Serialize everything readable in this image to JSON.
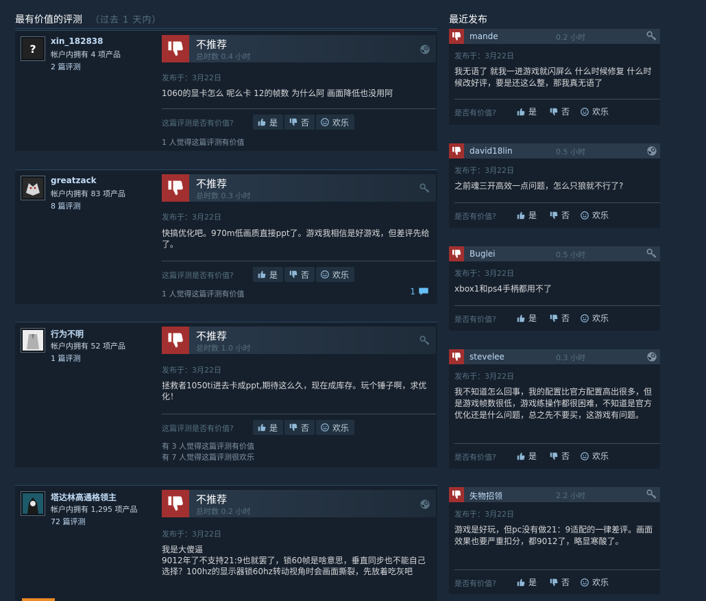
{
  "left_header": {
    "title": "最有价值的评测",
    "subtitle": "（过去 1 天内）"
  },
  "right_header": {
    "title": "最近发布"
  },
  "labels": {
    "helpful_q": "这篇评测是否有价值?",
    "yes": "是",
    "no": "否",
    "funny": "欢乐",
    "recent_helpful_q": "是否有价值?"
  },
  "reviews": [
    {
      "author": "xin_182838",
      "owned": "帐户内拥有 4 项产品",
      "review_count": "2 篇评测",
      "verdict": "不推荐",
      "hours": "总时数 0.4 小时",
      "platform": "steam-icon",
      "posted": "发布于：3月22日",
      "text": "1060的显卡怎么 呢么卡 12的帧数 为什么阿 画面降低也没用阿",
      "found": [
        "1 人觉得这篇评测有价值"
      ]
    },
    {
      "author": "greatzack",
      "owned": "帐户内拥有 83 项产品",
      "review_count": "8 篇评测",
      "verdict": "不推荐",
      "hours": "总时数 0.3 小时",
      "platform": "key-icon",
      "posted": "发布于：3月22日",
      "text": "快搞优化吧。970m低画质直接ppt了。游戏我相信是好游戏，但差评先给了。",
      "found": [
        "1 人觉得这篇评测有价值"
      ],
      "comments": "1"
    },
    {
      "author": "行为不明",
      "owned": "帐户内拥有 52 项产品",
      "review_count": "1 篇评测",
      "verdict": "不推荐",
      "hours": "总时数 1.0 小时",
      "platform": "key-icon",
      "posted": "发布于：3月22日",
      "text": "拯救者1050ti进去卡成ppt,期待这么久，现在成库存。玩个锤子啊，求优化！",
      "found": [
        "有 3 人觉得这篇评测有价值",
        "有 7 人觉得这篇评测很欢乐"
      ]
    },
    {
      "author": "塔达林高通格领主",
      "owned": "帐户内拥有 1,295 项产品",
      "review_count": "72 篇评测",
      "verdict": "不推荐",
      "hours": "总时数 0.2 小时",
      "platform": "steam-icon",
      "posted": "发布于：3月22日",
      "text": "我是大傻逼\n9012年了不支持21:9也就罢了，锁60帧是啥意思，垂直同步也不能自己选择？100hz的显示器锁60hz转动视角时会画面撕裂，先放着吃灰吧"
    }
  ],
  "recent": [
    {
      "name": "mande",
      "hours": "0.2 小时",
      "platform": "key-icon",
      "posted": "发布于：3月22日",
      "text": "我无语了 就我一进游戏就闪屏么 什么时候修复 什么时候改好评，要是还这么整，那我真无语了"
    },
    {
      "name": "david18lin",
      "hours": "0.5 小时",
      "platform": "steam-icon",
      "posted": "发布于：3月22日",
      "text": "之前魂三开高效一点问题，怎么只狼就不行了?"
    },
    {
      "name": "Buglei",
      "hours": "0.5 小时",
      "platform": "key-icon",
      "posted": "发布于：3月22日",
      "text": "xbox1和ps4手柄都用不了"
    },
    {
      "name": "stevelee",
      "hours": "0.3 小时",
      "platform": "steam-icon",
      "posted": "发布于：3月22日",
      "text": "我不知道怎么回事，我的配置比官方配置高出很多，但是游戏帧数很低，游戏练操作都很困难，不知道是官方优化还是什么问题，总之先不要买，这游戏有问题。"
    },
    {
      "name": "失物招领",
      "hours": "2.2 小时",
      "platform": "key-icon",
      "posted": "发布于：3月22日",
      "text": "游戏是好玩，但pc没有做21：9适配的一律差评。画面效果也要严重扣分，都9012了，略显寒酸了。"
    }
  ]
}
